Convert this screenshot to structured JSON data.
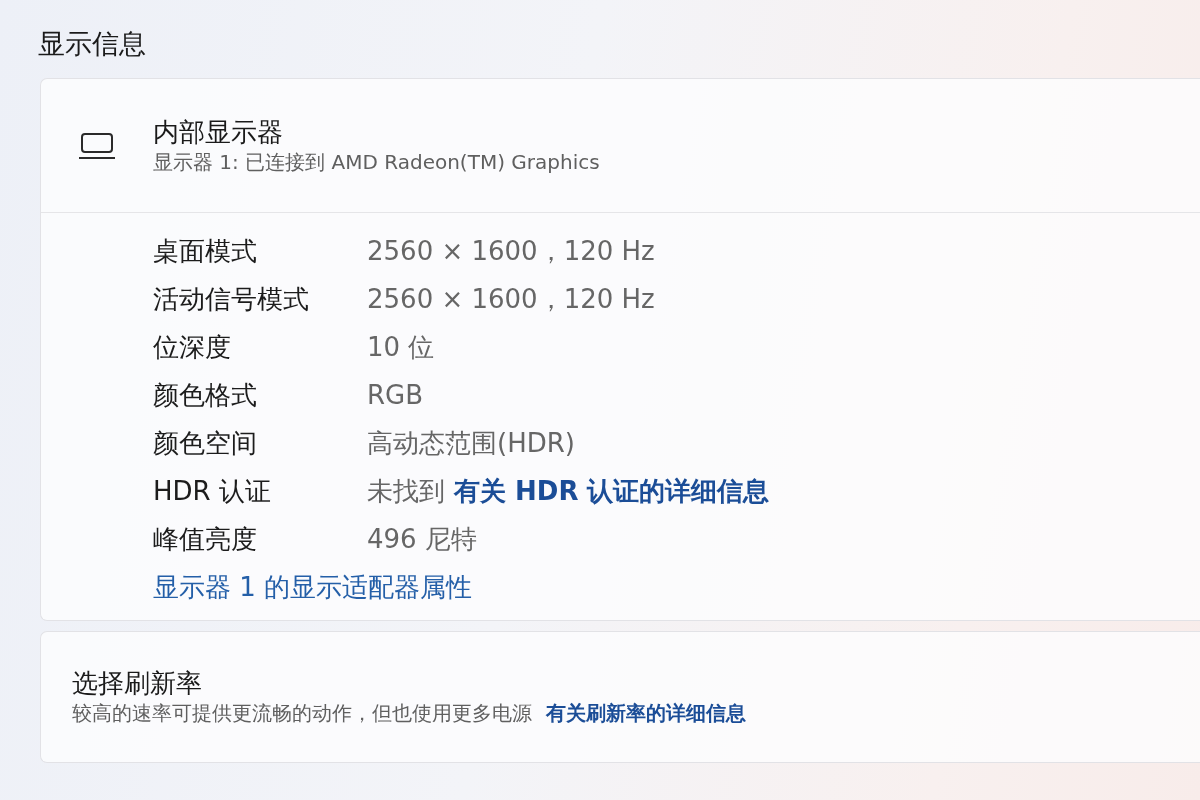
{
  "section_title": "显示信息",
  "display": {
    "name": "内部显示器",
    "description": "显示器 1: 已连接到 AMD Radeon(TM) Graphics",
    "properties": [
      {
        "label": "桌面模式",
        "value": "2560 × 1600，120 Hz"
      },
      {
        "label": "活动信号模式",
        "value": "2560 × 1600，120 Hz"
      },
      {
        "label": "位深度",
        "value": "10 位"
      },
      {
        "label": "颜色格式",
        "value": "RGB"
      },
      {
        "label": "颜色空间",
        "value": "高动态范围(HDR)"
      },
      {
        "label": "HDR 认证",
        "value": "未找到",
        "link": "有关 HDR 认证的详细信息"
      },
      {
        "label": "峰值亮度",
        "value": "496 尼特"
      }
    ],
    "adapter_link": "显示器 1 的显示适配器属性"
  },
  "refresh_rate": {
    "title": "选择刷新率",
    "description": "较高的速率可提供更流畅的动作，但也使用更多电源",
    "link": "有关刷新率的详细信息"
  }
}
